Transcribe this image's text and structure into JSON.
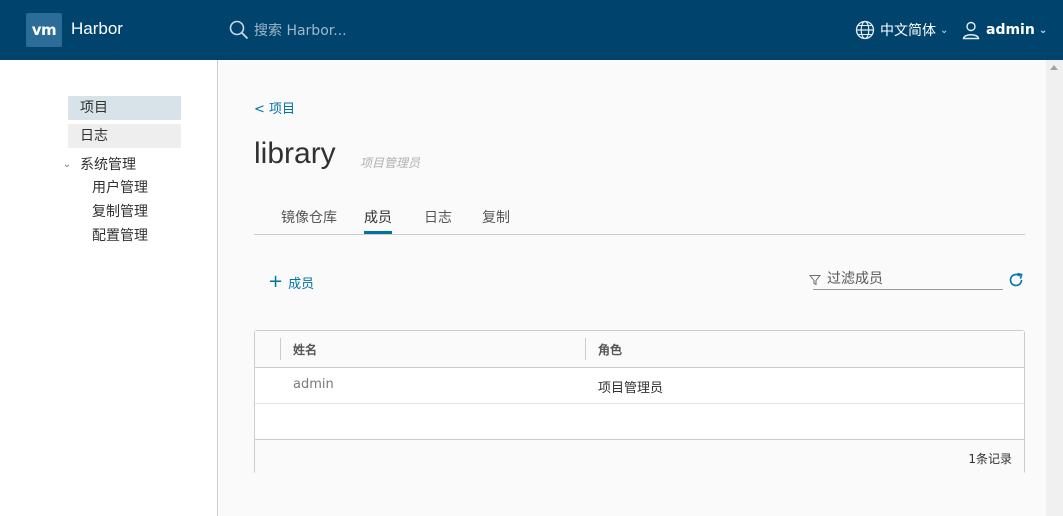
{
  "header": {
    "logo": "vm",
    "brand": "Harbor",
    "search_placeholder": "搜索 Harbor...",
    "language": "中文简体",
    "user": "admin"
  },
  "sidebar": {
    "items": [
      {
        "label": "项目"
      },
      {
        "label": "日志"
      }
    ],
    "group": {
      "label": "系统管理",
      "children": [
        {
          "label": "用户管理"
        },
        {
          "label": "复制管理"
        },
        {
          "label": "配置管理"
        }
      ]
    }
  },
  "main": {
    "breadcrumb": "< 项目",
    "title": "library",
    "role_tag": "项目管理员",
    "tabs": [
      {
        "label": "镜像仓库"
      },
      {
        "label": "成员"
      },
      {
        "label": "日志"
      },
      {
        "label": "复制"
      }
    ],
    "add_member": "成员",
    "filter_placeholder": "过滤成员",
    "table": {
      "columns": [
        "姓名",
        "角色"
      ],
      "rows": [
        {
          "name": "admin",
          "role": "项目管理员"
        }
      ],
      "footer": "1条记录"
    }
  },
  "colors": {
    "header_bg": "#00446e",
    "accent": "#0072a3"
  }
}
